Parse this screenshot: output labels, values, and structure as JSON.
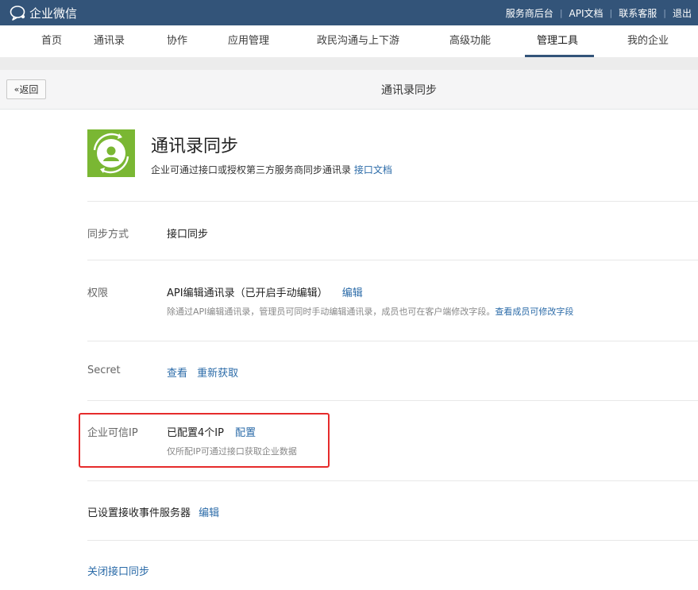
{
  "topbar": {
    "brand": "企业微信",
    "links": [
      "服务商后台",
      "API文档",
      "联系客服",
      "退出"
    ]
  },
  "nav": {
    "items": [
      "首页",
      "通讯录",
      "协作",
      "应用管理",
      "政民沟通与上下游",
      "高级功能",
      "管理工具",
      "我的企业"
    ],
    "active": "管理工具"
  },
  "header": {
    "back_label": "返回",
    "page_title": "通讯录同步"
  },
  "app": {
    "name": "通讯录同步",
    "description": "企业可通过接口或授权第三方服务商同步通讯录",
    "doc_link": "接口文档"
  },
  "rows": {
    "sync_method": {
      "label": "同步方式",
      "value": "接口同步"
    },
    "permission": {
      "label": "权限",
      "value": "API编辑通讯录（已开启手动编辑）",
      "edit": "编辑",
      "note": "除通过API编辑通讯录，管理员可同时手动编辑通讯录，成员也可在客户端修改字段。",
      "note_link": "查看成员可修改字段"
    },
    "secret": {
      "label": "Secret",
      "view": "查看",
      "refresh": "重新获取"
    },
    "trusted_ip": {
      "label": "企业可信IP",
      "value": "已配置4个IP",
      "configure": "配置",
      "note": "仅所配IP可通过接口获取企业数据"
    },
    "event_server": {
      "text": "已设置接收事件服务器",
      "edit": "编辑"
    }
  },
  "footer": {
    "close_sync": "关闭接口同步"
  },
  "colors": {
    "topbar": "#335479",
    "link": "#2b6ba8",
    "app_icon": "#7ab733",
    "highlight": "#e62b2b"
  }
}
